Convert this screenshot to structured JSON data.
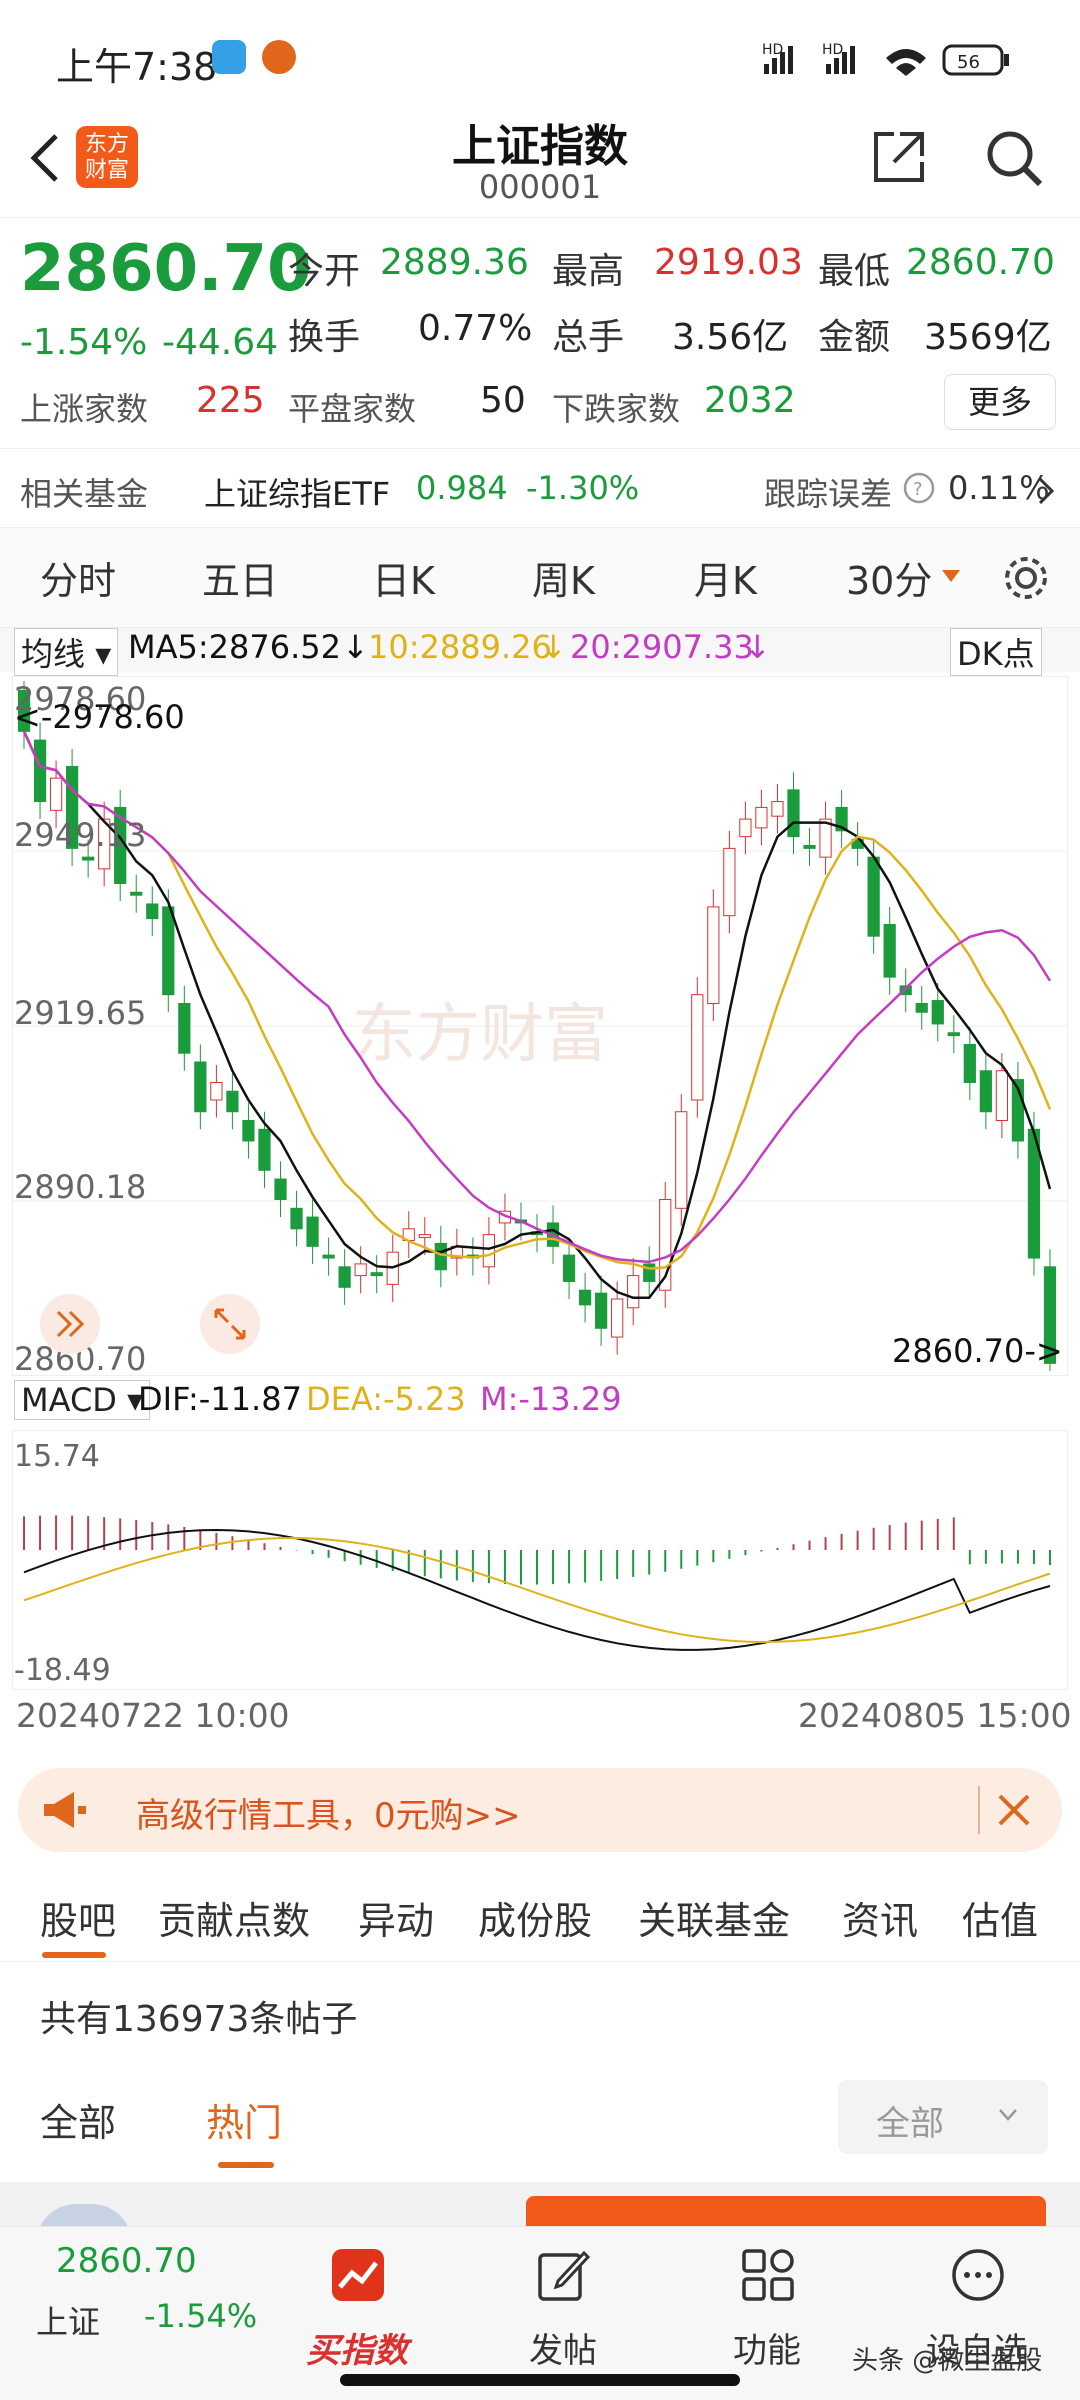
{
  "status": {
    "time": "上午7:38",
    "battery": "56",
    "network1": "HD",
    "network2": "HD"
  },
  "header": {
    "title": "上证指数",
    "code": "000001",
    "logo_text": "东方财富"
  },
  "quote": {
    "price": "2860.70",
    "pct": "-1.54%",
    "change": "-44.64",
    "open_label": "今开",
    "open": "2889.36",
    "high_label": "最高",
    "high": "2919.03",
    "low_label": "最低",
    "low": "2860.70",
    "turnover_label": "换手",
    "turnover": "0.77%",
    "volume_label": "总手",
    "volume": "3.56亿",
    "amount_label": "金额",
    "amount": "3569亿",
    "up_label": "上涨家数",
    "up": "225",
    "flat_label": "平盘家数",
    "flat": "50",
    "down_label": "下跌家数",
    "down": "2032",
    "more": "更多"
  },
  "fund": {
    "label": "相关基金",
    "name": "上证综指ETF",
    "price": "0.984",
    "pct": "-1.30%",
    "err_label": "跟踪误差",
    "err": "0.11%"
  },
  "tabs": [
    "分时",
    "五日",
    "日K",
    "周K",
    "月K",
    "30分"
  ],
  "ma": {
    "select": "均线",
    "ma5": "MA5:2876.52",
    "ma10": "10:2889.26",
    "ma20": "20:2907.33",
    "dk": "DK点"
  },
  "axis": {
    "y1": "2978.60",
    "y2": "2949.13",
    "y3": "2919.65",
    "y4": "2890.18",
    "y5": "2860.70",
    "max_label": "<-2978.60",
    "min_label": "2860.70->",
    "watermark": "东方财富"
  },
  "macd": {
    "select": "MACD",
    "dif": "DIF:-11.87",
    "dea": "DEA:-5.23",
    "m": "M:-13.29",
    "top": "15.74",
    "bottom": "-18.49"
  },
  "dates": {
    "start": "20240722 10:00",
    "end": "20240805 15:00"
  },
  "chart_data": {
    "type": "candlestick",
    "title": "上证指数 30分",
    "ylim": [
      2860.7,
      2978.6
    ],
    "close": [
      2970,
      2958,
      2962,
      2950,
      2948,
      2955,
      2944,
      2942,
      2938,
      2925,
      2915,
      2905,
      2910,
      2905,
      2900,
      2895,
      2890,
      2885,
      2882,
      2880,
      2875,
      2879,
      2877,
      2881,
      2885,
      2884,
      2878,
      2882,
      2880,
      2884,
      2888,
      2886,
      2884,
      2882,
      2876,
      2872,
      2868,
      2873,
      2877,
      2876,
      2890,
      2905,
      2925,
      2940,
      2950,
      2955,
      2957,
      2958,
      2952,
      2950,
      2955,
      2953,
      2950,
      2935,
      2928,
      2925,
      2922,
      2920,
      2918,
      2910,
      2905,
      2912,
      2900,
      2880,
      2862
    ],
    "ma_labels": [
      "MA5",
      "MA10",
      "MA20"
    ],
    "ma_colors": [
      "#111111",
      "#e0b21a",
      "#c43cc4"
    ]
  }
}
